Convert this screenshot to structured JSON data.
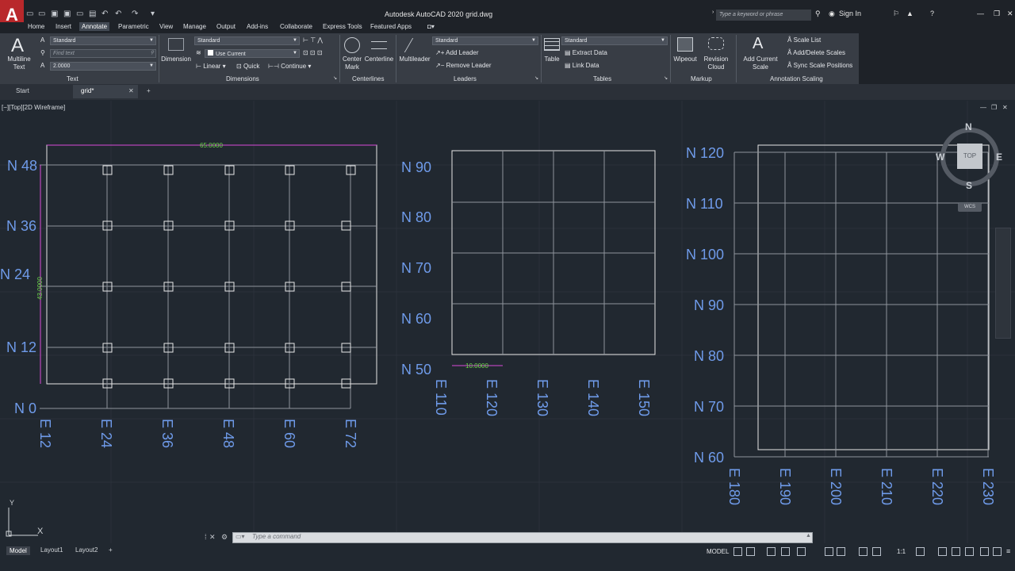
{
  "app": {
    "logo": "A",
    "title": "Autodesk AutoCAD 2020    grid.dwg",
    "search_placeholder": "Type a keyword or phrase",
    "sign_in": "Sign In"
  },
  "ribbon_tabs": [
    "Home",
    "Insert",
    "Annotate",
    "Parametric",
    "View",
    "Manage",
    "Output",
    "Add-ins",
    "Collaborate",
    "Express Tools",
    "Featured Apps"
  ],
  "text_panel": {
    "multiline_text": "Multiline Text",
    "style": "Standard",
    "find_placeholder": "Find text",
    "height": "2.0000",
    "title": "Text"
  },
  "dimensions_panel": {
    "dimension": "Dimension",
    "style": "Standard",
    "layer": "Use Current",
    "linear": "Linear",
    "quick": "Quick",
    "continue": "Continue",
    "title": "Dimensions"
  },
  "centerlines_panel": {
    "center_mark": "Center Mark",
    "centerline": "Centerline",
    "title": "Centerlines"
  },
  "leaders_panel": {
    "multileader": "Multileader",
    "style": "Standard",
    "add_leader": "Add Leader",
    "remove_leader": "Remove Leader",
    "title": "Leaders"
  },
  "tables_panel": {
    "table": "Table",
    "style": "Standard",
    "extract_data": "Extract Data",
    "link_data": "Link Data",
    "title": "Tables"
  },
  "markup_panel": {
    "wipeout": "Wipeout",
    "revision_cloud": "Revision Cloud",
    "title": "Markup"
  },
  "scaling_panel": {
    "add_current_scale": "Add Current Scale",
    "scale_list": "Scale List",
    "add_delete_scales": "Add/Delete Scales",
    "sync_scale_positions": "Sync Scale Positions",
    "title": "Annotation Scaling"
  },
  "doc_tabs": [
    "Start",
    "grid*"
  ],
  "viewport_label": "[−][Top][2D Wireframe]",
  "compass": {
    "n": "N",
    "s": "S",
    "e": "E",
    "w": "W",
    "top": "TOP",
    "wcs": "WCS"
  },
  "drawing1": {
    "north": [
      "N 48",
      "N 36",
      "N 24",
      "N 12",
      "N 0"
    ],
    "east": [
      "E 12",
      "E 24",
      "E 36",
      "E 48",
      "E 60",
      "E 72"
    ],
    "dim_h": "65.0000",
    "dim_v": "43.0000"
  },
  "drawing2": {
    "north": [
      "N 90",
      "N 80",
      "N 70",
      "N 60",
      "N 50"
    ],
    "east": [
      "E 110",
      "E 120",
      "E 130",
      "E 140",
      "E 150"
    ],
    "dim": "10.0000"
  },
  "drawing3": {
    "north": [
      "N 120",
      "N 110",
      "N 100",
      "N 90",
      "N 80",
      "N 70",
      "N 60"
    ],
    "east": [
      "E 180",
      "E 190",
      "E 200",
      "E 210",
      "E 220",
      "E 230"
    ]
  },
  "command": {
    "placeholder": "Type a command"
  },
  "status": {
    "tabs": [
      "Model",
      "Layout1",
      "Layout2"
    ],
    "model": "MODEL",
    "scale": "1:1"
  },
  "ucs": {
    "x": "X",
    "y": "Y"
  }
}
